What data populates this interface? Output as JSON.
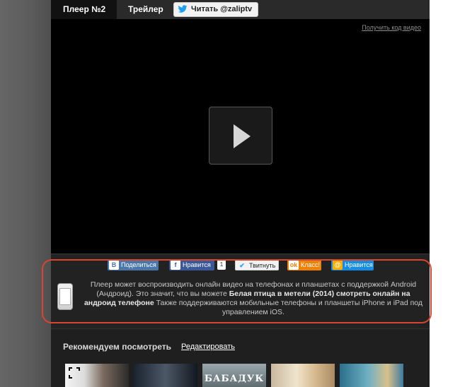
{
  "tabs": [
    {
      "label": "Плеер №2",
      "active": true
    },
    {
      "label": "Трейлер",
      "active": false
    }
  ],
  "twitter_button": {
    "label": "Читать @zaliptv"
  },
  "video": {
    "get_code_link": "Получить код видео"
  },
  "share_buttons": [
    {
      "icon": "vk-icon",
      "label": "Поделиться",
      "color": "#4a76a8"
    },
    {
      "icon": "facebook-icon",
      "label": "Нравится",
      "color": "#3b5998",
      "count": "1"
    },
    {
      "icon": "twitter-icon",
      "label": "Твитнуть",
      "color": "#f2f2f2"
    },
    {
      "icon": "odnoklassniki-icon",
      "label": "Класс!",
      "color": "#ee8208"
    },
    {
      "icon": "mailru-icon",
      "label": "Нравится",
      "color": "#168de2"
    }
  ],
  "android_info": {
    "text_before": "Плеер может воспроизводить онлайн видео на телефонах и планшетах с поддержкой Android (Андроид). Это значит, что вы можете ",
    "bold": "Белая птица в метели (2014) смотреть онлайн на андроид телефоне",
    "text_after": " Также поддерживаются мобильные телефоны и планшеты iPhone и iPad под управлением iOS."
  },
  "recommendations": {
    "title": "Рекомендуем посмотреть",
    "edit_link": "Редактировать",
    "thumbnails": [
      {
        "name": "movie-thumb-1",
        "caption": ""
      },
      {
        "name": "movie-thumb-2",
        "caption": ""
      },
      {
        "name": "movie-thumb-3",
        "caption": "БАБАДУК"
      },
      {
        "name": "movie-thumb-4",
        "caption": ""
      },
      {
        "name": "movie-thumb-5",
        "caption": ""
      }
    ]
  },
  "colors": {
    "accent_border": "#d9452f",
    "panel": "#222222",
    "video": "#000000"
  }
}
